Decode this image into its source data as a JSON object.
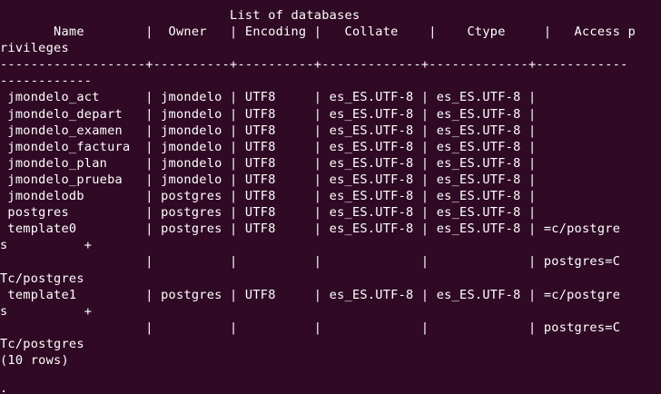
{
  "terminal": {
    "lines": [
      "                              List of databases",
      "       Name        |  Owner   | Encoding |   Collate    |    Ctype     |   Access p",
      "rivileges",
      "-------------------+----------+----------+-------------+-------------+------------",
      "------------",
      " jmondelo_act      | jmondelo | UTF8     | es_ES.UTF-8 | es_ES.UTF-8 | ",
      " jmondelo_depart   | jmondelo | UTF8     | es_ES.UTF-8 | es_ES.UTF-8 | ",
      " jmondelo_examen   | jmondelo | UTF8     | es_ES.UTF-8 | es_ES.UTF-8 | ",
      " jmondelo_factura  | jmondelo | UTF8     | es_ES.UTF-8 | es_ES.UTF-8 | ",
      " jmondelo_plan     | jmondelo | UTF8     | es_ES.UTF-8 | es_ES.UTF-8 | ",
      " jmondelo_prueba   | jmondelo | UTF8     | es_ES.UTF-8 | es_ES.UTF-8 | ",
      " jmondelodb        | postgres | UTF8     | es_ES.UTF-8 | es_ES.UTF-8 | ",
      " postgres          | postgres | UTF8     | es_ES.UTF-8 | es_ES.UTF-8 | ",
      " template0         | postgres | UTF8     | es_ES.UTF-8 | es_ES.UTF-8 | =c/postgre",
      "s          +",
      "                   |          |          |             |             | postgres=C",
      "Tc/postgres",
      " template1         | postgres | UTF8     | es_ES.UTF-8 | es_ES.UTF-8 | =c/postgre",
      "s          +",
      "                   |          |          |             |             | postgres=C",
      "Tc/postgres",
      "(10 rows)",
      "",
      ":"
    ]
  }
}
